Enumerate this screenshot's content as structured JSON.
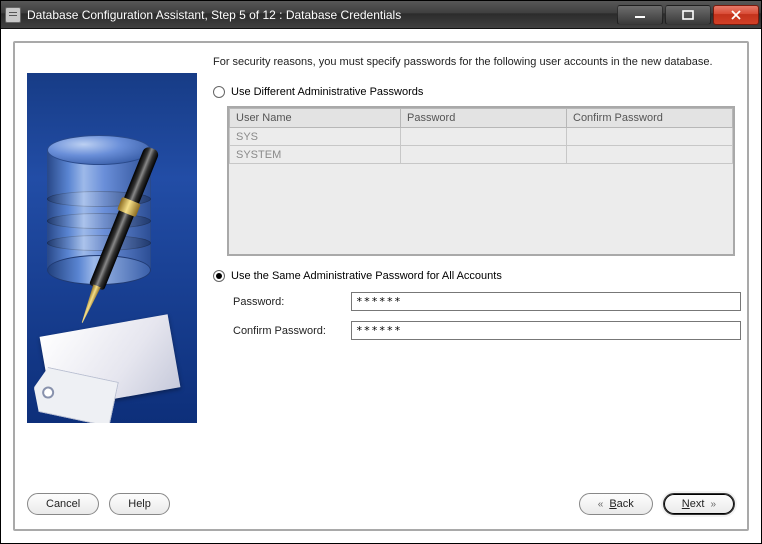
{
  "window": {
    "title": "Database Configuration Assistant, Step 5 of 12 : Database Credentials"
  },
  "intro": "For security reasons, you must specify passwords for the following user accounts in the new database.",
  "option_different": {
    "label": "Use Different Administrative Passwords",
    "checked": false
  },
  "table": {
    "headers": {
      "user": "User Name",
      "password": "Password",
      "confirm": "Confirm Password"
    },
    "rows": [
      {
        "user": "SYS",
        "password": "",
        "confirm": ""
      },
      {
        "user": "SYSTEM",
        "password": "",
        "confirm": ""
      }
    ]
  },
  "option_same": {
    "label": "Use the Same Administrative Password for All Accounts",
    "checked": true
  },
  "same_fields": {
    "password_label": "Password:",
    "password_value": "******",
    "confirm_label": "Confirm Password:",
    "confirm_value": "******"
  },
  "buttons": {
    "cancel": "Cancel",
    "help": "Help",
    "back": "Back",
    "next": "Next"
  }
}
